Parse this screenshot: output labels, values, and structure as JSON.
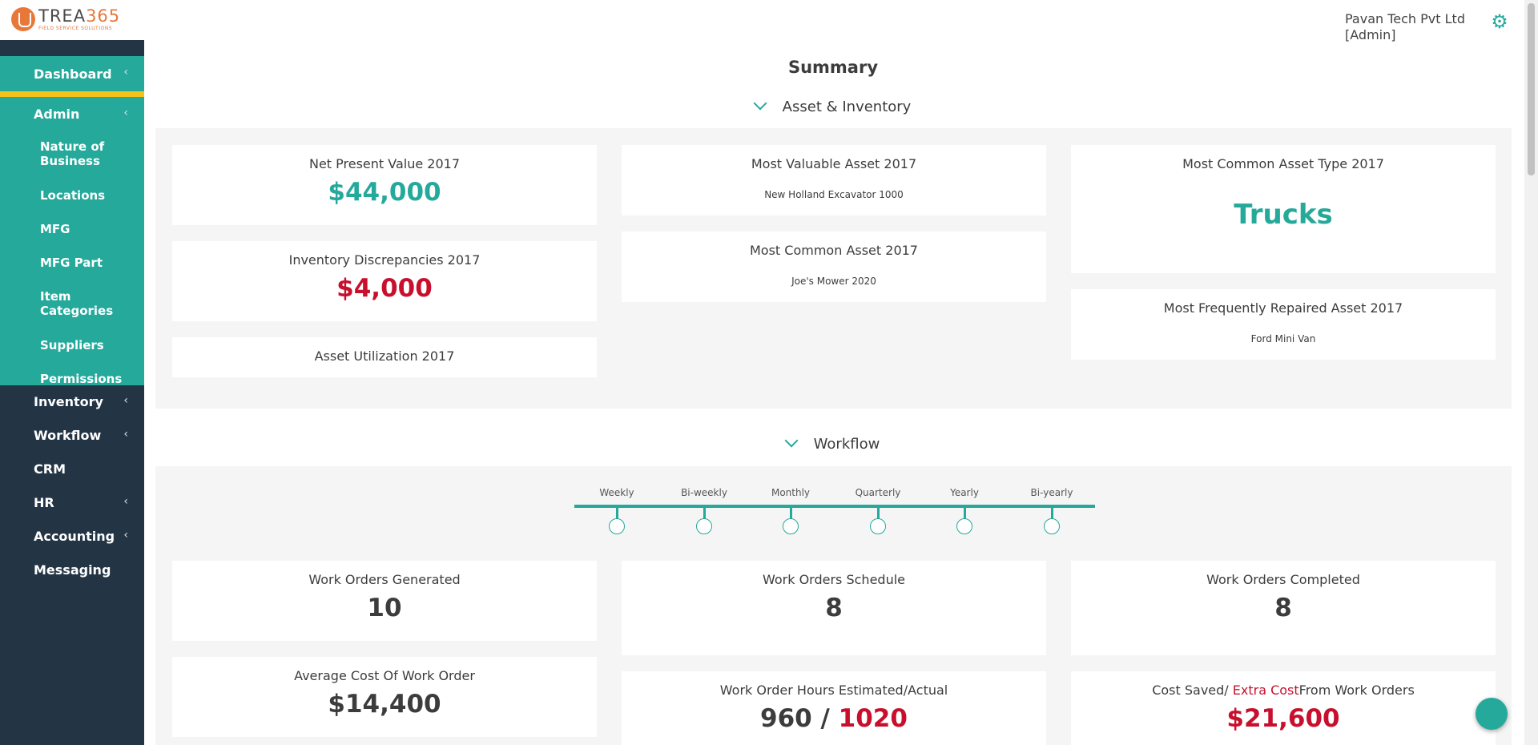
{
  "header": {
    "logo_title_text": "TREA",
    "logo_title_num": "365",
    "logo_subtitle": "FIELD SERVICE SOLUTIONS",
    "company_name": "Pavan Tech Pvt Ltd",
    "company_role": "[Admin]",
    "settings_icon": "gear-icon"
  },
  "sidebar": {
    "dashboard": "Dashboard",
    "admin": "Admin",
    "admin_items": [
      "Nature of Business",
      "Locations",
      "MFG",
      "MFG Part",
      "Item Categories",
      "Suppliers",
      "Permissions"
    ],
    "inventory": "Inventory",
    "workflow": "Workflow",
    "crm": "CRM",
    "hr": "HR",
    "accounting": "Accounting",
    "messaging": "Messaging"
  },
  "colors": {
    "accent": "#25a99b",
    "sidebar_bg": "#233445",
    "active_border": "#f5c21b",
    "negative": "#c8102e",
    "logo_orange": "#e8773a"
  },
  "main": {
    "title": "Summary",
    "asset_section": {
      "title": "Asset & Inventory",
      "net_present_value": {
        "title": "Net Present Value 2017",
        "value": "$44,000"
      },
      "inventory_discrepancies": {
        "title": "Inventory Discrepancies 2017",
        "value": "$4,000"
      },
      "asset_utilization": {
        "title": "Asset Utilization 2017"
      },
      "most_valuable_asset": {
        "title": "Most Valuable Asset 2017",
        "value": "New Holland Excavator 1000"
      },
      "most_common_asset": {
        "title": "Most Common Asset 2017",
        "value": "Joe's Mower 2020"
      },
      "most_common_asset_type": {
        "title": "Most Common Asset Type 2017",
        "value": "Trucks"
      },
      "most_repaired_asset": {
        "title": "Most Frequently Repaired Asset 2017",
        "value": "Ford Mini Van"
      }
    },
    "workflow_section": {
      "title": "Workflow",
      "timeline": [
        "Weekly",
        "Bi-weekly",
        "Monthly",
        "Quarterly",
        "Yearly",
        "Bi-yearly"
      ],
      "work_orders_generated": {
        "title": "Work Orders Generated",
        "value": "10"
      },
      "work_orders_schedule": {
        "title": "Work Orders Schedule",
        "value": "8"
      },
      "work_orders_completed": {
        "title": "Work Orders Completed",
        "value": "8"
      },
      "average_cost": {
        "title": "Average Cost Of Work Order",
        "value": "$14,400"
      },
      "hours": {
        "title": "Work Order Hours Estimated/Actual",
        "estimated": "960",
        "separator": " / ",
        "actual": "1020"
      },
      "cost_saved": {
        "title_a": "Cost Saved/ ",
        "title_b": "Extra Cost",
        "title_c": "From Work Orders",
        "value": "$21,600"
      }
    }
  }
}
